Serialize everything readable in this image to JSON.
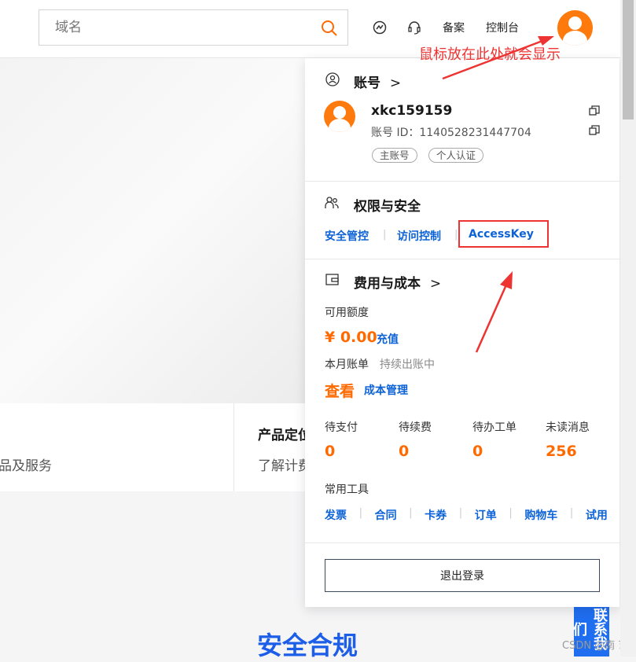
{
  "header": {
    "search_placeholder": "域名",
    "beian": "备案",
    "console": "控制台"
  },
  "annotation": {
    "text": "鼠标放在此处就会显示",
    "color": "#ee3333"
  },
  "background": {
    "card_title": "产品定位",
    "card_desc_left": "品及服务",
    "card_desc_right": "了解计费",
    "section_title": "安全合规",
    "contact_tab": "联系我们",
    "watermark": "CSDN @南 艺"
  },
  "panel": {
    "account": {
      "title": "账号",
      "username": "xkc159159",
      "id_label": "账号 ID：",
      "id_value": "1140528231447704",
      "tags": [
        "主账号",
        "个人认证"
      ]
    },
    "security": {
      "title": "权限与安全",
      "links": [
        "安全管控",
        "访问控制",
        "AccessKey"
      ]
    },
    "billing": {
      "title": "费用与成本",
      "available_label": "可用额度",
      "balance": "¥ 0.00",
      "recharge": "充值",
      "bill_label": "本月账单",
      "bill_status": "持续出账中",
      "view": "查看",
      "cost_mgmt": "成本管理"
    },
    "stats": [
      {
        "label": "待支付",
        "value": "0"
      },
      {
        "label": "待续费",
        "value": "0"
      },
      {
        "label": "待办工单",
        "value": "0"
      },
      {
        "label": "未读消息",
        "value": "256"
      }
    ],
    "tools": {
      "title": "常用工具",
      "links": [
        "发票",
        "合同",
        "卡券",
        "订单",
        "购物车",
        "试用"
      ]
    },
    "logout": "退出登录"
  },
  "colors": {
    "accent": "#0c62d6",
    "orange": "#ff6a00",
    "highlight_box": "#ee3333"
  }
}
